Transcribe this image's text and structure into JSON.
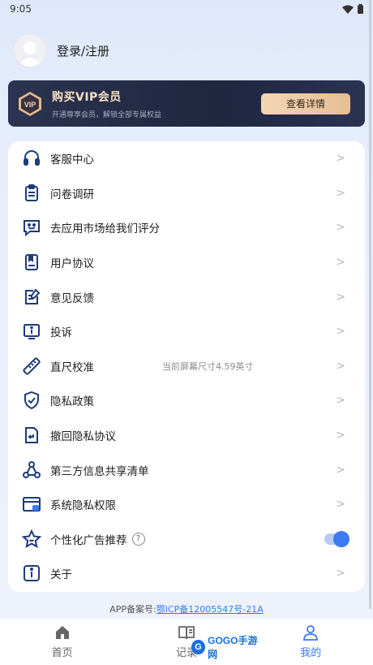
{
  "status": {
    "time": "9:05"
  },
  "profile": {
    "login_label": "登录/注册"
  },
  "vip": {
    "badge_text": "VIP",
    "title": "购买VIP会员",
    "subtitle": "开通尊享会员，解锁全部专属权益",
    "button": "查看详情"
  },
  "menu": {
    "items": [
      {
        "label": "客服中心",
        "icon": "headset-icon"
      },
      {
        "label": "问卷调研",
        "icon": "clipboard-icon"
      },
      {
        "label": "去应用市场给我们评分",
        "icon": "smile-chat-icon"
      },
      {
        "label": "用户协议",
        "icon": "bookmark-doc-icon"
      },
      {
        "label": "意见反馈",
        "icon": "edit-note-icon"
      },
      {
        "label": "投诉",
        "icon": "info-screen-icon"
      },
      {
        "label": "直尺校准",
        "icon": "ruler-icon",
        "extra": "当前屏幕尺寸4.59英寸"
      },
      {
        "label": "隐私政策",
        "icon": "shield-check-icon"
      },
      {
        "label": "撤回隐私协议",
        "icon": "return-doc-icon"
      },
      {
        "label": "第三方信息共享清单",
        "icon": "share-nodes-icon"
      },
      {
        "label": "系统隐私权限",
        "icon": "browser-lock-icon"
      },
      {
        "label": "个性化广告推荐",
        "icon": "star-face-icon",
        "help": "?"
      },
      {
        "label": "关于",
        "icon": "info-icon"
      }
    ],
    "chevron": ">"
  },
  "icp": {
    "prefix": "APP备案号:",
    "link": "鄂ICP备12005547号-21A"
  },
  "tabs": [
    {
      "label": "首页",
      "icon": "home-icon"
    },
    {
      "label": "记录",
      "icon": "book-icon"
    },
    {
      "label": "我的",
      "icon": "user-icon"
    }
  ],
  "watermark": {
    "text": "GOGO手游网"
  },
  "colors": {
    "accent": "#3a7af2",
    "vip_gold": "#f3d6b6",
    "vip_bg": "#1f2640"
  }
}
